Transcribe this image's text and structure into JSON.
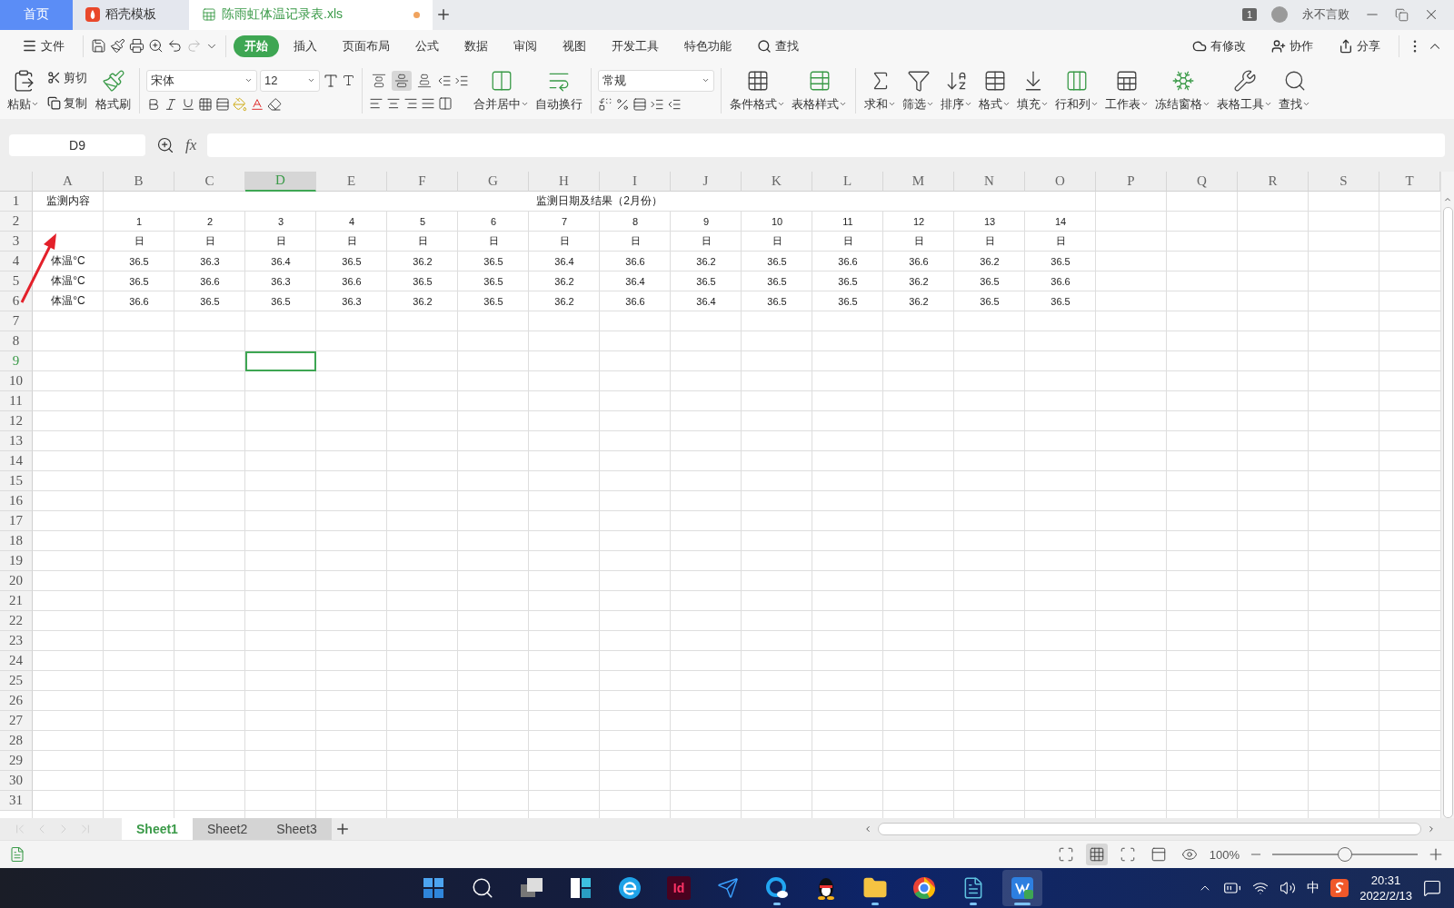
{
  "title_bar": {
    "tabs": [
      {
        "label": "首页",
        "kind": "home",
        "selected": false,
        "unsaved": false
      },
      {
        "label": "稻壳模板",
        "kind": "template",
        "selected": false,
        "unsaved": false
      },
      {
        "label": "陈雨虹体温记录表.xls",
        "kind": "sheet",
        "selected": true,
        "unsaved": true
      }
    ],
    "page_count": "1",
    "user": "永不言败"
  },
  "menu": {
    "file": "文件",
    "tabs": [
      {
        "label": "开始",
        "selected": true
      },
      {
        "label": "插入",
        "selected": false
      },
      {
        "label": "页面布局",
        "selected": false
      },
      {
        "label": "公式",
        "selected": false
      },
      {
        "label": "数据",
        "selected": false
      },
      {
        "label": "审阅",
        "selected": false
      },
      {
        "label": "视图",
        "selected": false
      },
      {
        "label": "开发工具",
        "selected": false
      },
      {
        "label": "特色功能",
        "selected": false
      }
    ],
    "search": "查找",
    "actions": [
      "有修改",
      "协作",
      "分享"
    ]
  },
  "ribbon": {
    "paste": "粘贴",
    "cut": "剪切",
    "copy": "复制",
    "format_painter": "格式刷",
    "font": "宋体",
    "font_size": "12",
    "alignment": [
      {
        "selected": false
      },
      {
        "selected": true
      },
      {
        "selected": false
      }
    ],
    "merge": "合并居中",
    "wrap": "自动换行",
    "number_format": "常规",
    "tools": [
      "条件格式",
      "表格样式",
      "求和",
      "筛选",
      "排序",
      "格式",
      "填充",
      "行和列",
      "工作表",
      "冻结窗格",
      "表格工具",
      "查找"
    ]
  },
  "formula_bar": {
    "name_box": "D9",
    "fx": "fx"
  },
  "sheet": {
    "columns": [
      {
        "label": "A",
        "selected": false
      },
      {
        "label": "B",
        "selected": false
      },
      {
        "label": "C",
        "selected": false
      },
      {
        "label": "D",
        "selected": true
      },
      {
        "label": "E",
        "selected": false
      },
      {
        "label": "F",
        "selected": false
      },
      {
        "label": "G",
        "selected": false
      },
      {
        "label": "H",
        "selected": false
      },
      {
        "label": "I",
        "selected": false
      },
      {
        "label": "J",
        "selected": false
      },
      {
        "label": "K",
        "selected": false
      },
      {
        "label": "L",
        "selected": false
      },
      {
        "label": "M",
        "selected": false
      },
      {
        "label": "N",
        "selected": false
      },
      {
        "label": "O",
        "selected": false
      },
      {
        "label": "P",
        "selected": false
      },
      {
        "label": "Q",
        "selected": false
      },
      {
        "label": "R",
        "selected": false
      },
      {
        "label": "S",
        "selected": false
      },
      {
        "label": "T",
        "selected": false
      }
    ],
    "rows": [
      {
        "number": "1",
        "selected": false,
        "kind": "title",
        "cells": [
          "监测内容",
          "监测日期及结果（2月份）"
        ]
      },
      {
        "number": "2",
        "selected": false,
        "kind": "data",
        "cells": [
          "",
          "1",
          "2",
          "3",
          "4",
          "5",
          "6",
          "7",
          "8",
          "9",
          "10",
          "11",
          "12",
          "13",
          "14"
        ]
      },
      {
        "number": "3",
        "selected": false,
        "kind": "data",
        "cells": [
          "",
          "日",
          "日",
          "日",
          "日",
          "日",
          "日",
          "日",
          "日",
          "日",
          "日",
          "日",
          "日",
          "日",
          "日"
        ]
      },
      {
        "number": "4",
        "selected": false,
        "kind": "data",
        "cells": [
          "体温°C",
          "36.5",
          "36.3",
          "36.4",
          "36.5",
          "36.2",
          "36.5",
          "36.4",
          "36.6",
          "36.2",
          "36.5",
          "36.6",
          "36.6",
          "36.2",
          "36.5"
        ]
      },
      {
        "number": "5",
        "selected": false,
        "kind": "data",
        "cells": [
          "体温°C",
          "36.5",
          "36.6",
          "36.3",
          "36.6",
          "36.5",
          "36.5",
          "36.2",
          "36.4",
          "36.5",
          "36.5",
          "36.5",
          "36.2",
          "36.5",
          "36.6"
        ]
      },
      {
        "number": "6",
        "selected": false,
        "kind": "data",
        "cells": [
          "体温°C",
          "36.6",
          "36.5",
          "36.5",
          "36.3",
          "36.2",
          "36.5",
          "36.2",
          "36.6",
          "36.4",
          "36.5",
          "36.5",
          "36.2",
          "36.5",
          "36.5"
        ]
      },
      {
        "number": "7",
        "selected": false
      },
      {
        "number": "8",
        "selected": false
      },
      {
        "number": "9",
        "selected": true
      },
      {
        "number": "10",
        "selected": false
      },
      {
        "number": "11",
        "selected": false
      },
      {
        "number": "12",
        "selected": false
      },
      {
        "number": "13",
        "selected": false
      },
      {
        "number": "14",
        "selected": false
      },
      {
        "number": "15",
        "selected": false
      },
      {
        "number": "16",
        "selected": false
      },
      {
        "number": "17",
        "selected": false
      },
      {
        "number": "18",
        "selected": false
      },
      {
        "number": "19",
        "selected": false
      },
      {
        "number": "20",
        "selected": false
      },
      {
        "number": "21",
        "selected": false
      },
      {
        "number": "22",
        "selected": false
      },
      {
        "number": "23",
        "selected": false
      },
      {
        "number": "24",
        "selected": false
      },
      {
        "number": "25",
        "selected": false
      },
      {
        "number": "26",
        "selected": false
      },
      {
        "number": "27",
        "selected": false
      },
      {
        "number": "28",
        "selected": false
      },
      {
        "number": "29",
        "selected": false
      },
      {
        "number": "30",
        "selected": false
      },
      {
        "number": "31",
        "selected": false
      }
    ]
  },
  "sheet_tabs": [
    {
      "label": "Sheet1",
      "selected": true
    },
    {
      "label": "Sheet2",
      "selected": false
    },
    {
      "label": "Sheet3",
      "selected": false
    }
  ],
  "status_bar": {
    "views": [
      {
        "selected": false
      },
      {
        "selected": true
      },
      {
        "selected": false
      },
      {
        "selected": false
      },
      {
        "selected": false
      }
    ],
    "zoom": "100%",
    "zoom_slider": {
      "level": 0.5
    }
  },
  "taskbar": {
    "apps": [
      {
        "kind": "start",
        "running": false,
        "active": false
      },
      {
        "kind": "search",
        "running": false,
        "active": false
      },
      {
        "kind": "taskview",
        "running": false,
        "active": false
      },
      {
        "kind": "widgets",
        "running": false,
        "active": false
      },
      {
        "kind": "browser",
        "running": false,
        "active": false
      },
      {
        "kind": "design",
        "label": "Id",
        "running": false,
        "active": false
      },
      {
        "kind": "bird",
        "running": false,
        "active": false
      },
      {
        "kind": "qbrowser",
        "running": true,
        "active": false
      },
      {
        "kind": "penguin",
        "running": false,
        "active": false
      },
      {
        "kind": "folder",
        "running": true,
        "active": false
      },
      {
        "kind": "chrome",
        "running": false,
        "active": false
      },
      {
        "kind": "notepad",
        "running": true,
        "active": false
      },
      {
        "kind": "wps",
        "running": true,
        "active": true
      }
    ],
    "ime": "中",
    "time": "20:31",
    "date": "2022/2/13"
  }
}
